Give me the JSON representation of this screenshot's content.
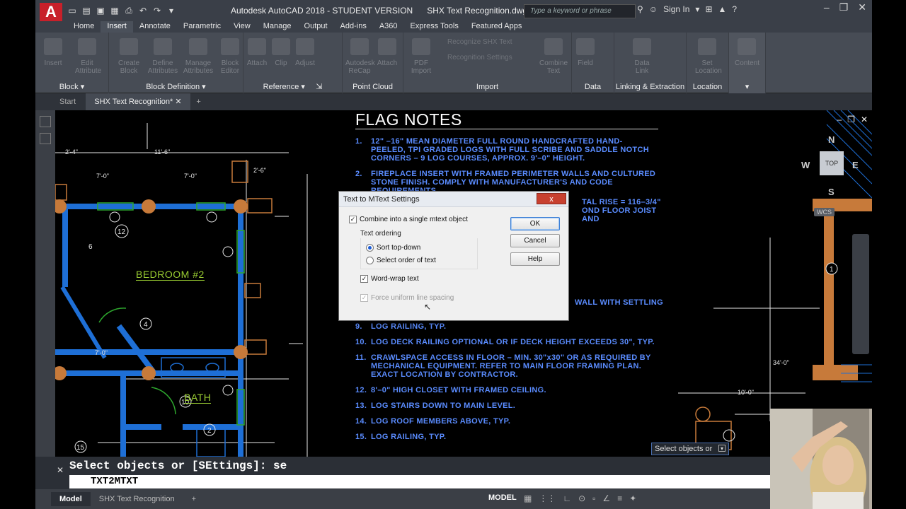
{
  "app": {
    "logo": "A",
    "title": "Autodesk AutoCAD 2018 - STUDENT VERSION",
    "filename": "SHX Text Recognition.dwg",
    "search_placeholder": "Type a keyword or phrase",
    "sign_in": "Sign In"
  },
  "ribbon_tabs": [
    "Home",
    "Insert",
    "Annotate",
    "Parametric",
    "View",
    "Manage",
    "Output",
    "Add-ins",
    "A360",
    "Express Tools",
    "Featured Apps"
  ],
  "ribbon": {
    "block": {
      "label": "Block",
      "buttons": [
        "Insert",
        "Edit Attribute"
      ]
    },
    "block_definition": {
      "label": "Block Definition",
      "buttons": [
        "Create Block",
        "Define Attributes",
        "Manage Attributes",
        "Block Editor"
      ]
    },
    "reference": {
      "label": "Reference",
      "buttons": [
        "Attach",
        "Clip",
        "Adjust"
      ]
    },
    "point_cloud": {
      "label": "Point Cloud",
      "buttons": [
        "Autodesk ReCap",
        "Attach"
      ]
    },
    "import": {
      "label": "Import",
      "buttons": [
        "PDF Import",
        "Combine Text"
      ],
      "sub": [
        "Recognize SHX Text",
        "Recognition Settings"
      ]
    },
    "data": {
      "label": "Data",
      "buttons": [
        "Field"
      ]
    },
    "linking": {
      "label": "Linking & Extraction",
      "buttons": [
        "Data Link"
      ]
    },
    "location": {
      "label": "Location",
      "buttons": [
        "Set Location"
      ]
    },
    "content": {
      "label": "Content"
    }
  },
  "doc_tabs": {
    "start": "Start",
    "active": "SHX Text Recognition*"
  },
  "drawing": {
    "notes_title": "FLAG NOTES",
    "notes": [
      {
        "n": "1.",
        "text": "12\" –16\" MEAN DIAMETER FULL ROUND HANDCRAFTED HAND-PEELED, TPI GRADED LOGS WITH FULL SCRIBE AND SADDLE NOTCH CORNERS – 9 LOG COURSES, APPROX. 9'–0\" HEIGHT."
      },
      {
        "n": "2.",
        "text": "FIREPLACE INSERT WITH FRAMED PERIMETER WALLS AND CULTURED STONE FINISH. COMPLY WITH MANUFACTURER'S AND CODE REQUIREMENTS."
      }
    ],
    "notes_lower": [
      {
        "n": "9.",
        "text": "LOG RAILING, TYP."
      },
      {
        "n": "10.",
        "text": "LOG DECK RAILING OPTIONAL OR IF DECK HEIGHT EXCEEDS 30\", TYP."
      },
      {
        "n": "11.",
        "text": "CRAWLSPACE ACCESS IN FLOOR – MIN. 30\"x30\" OR AS REQUIRED BY MECHANICAL EQUIPMENT. REFER TO MAIN FLOOR FRAMING PLAN. EXACT LOCATION BY CONTRACTOR."
      },
      {
        "n": "12.",
        "text": "8'–0\" HIGH CLOSET WITH FRAMED CEILING."
      },
      {
        "n": "13.",
        "text": "LOG STAIRS DOWN TO MAIN LEVEL."
      },
      {
        "n": "14.",
        "text": "LOG ROOF MEMBERS ABOVE, TYP."
      },
      {
        "n": "15.",
        "text": "LOG RAILING, TYP."
      }
    ],
    "note_fragments": [
      "TAL RISE = 116–3/4\"",
      "OND FLOOR JOIST AND",
      "WALL WITH SETTLING"
    ],
    "room_bedroom": "BEDROOM #2",
    "room_bath": "BATH",
    "dims": [
      "2'-4\"",
      "11'-6\"",
      "7'-0\"",
      "7'-0\"",
      "2'-6\"",
      "7'-0\"",
      "10'-0\"",
      "34'-0\""
    ],
    "tags": [
      "12",
      "6",
      "4",
      "10",
      "2",
      "15",
      "1"
    ],
    "compass": {
      "n": "N",
      "s": "S",
      "e": "E",
      "w": "W",
      "top": "TOP",
      "wcs": "WCS"
    },
    "tooltip": "Select objects or"
  },
  "dialog": {
    "title": "Text to MText Settings",
    "close": "x",
    "combine": "Combine into a single mtext object",
    "combine_checked": true,
    "group_label": "Text ordering",
    "sort_top_down": "Sort top-down",
    "select_order": "Select order of text",
    "selected_order": "sort_top_down",
    "word_wrap": "Word-wrap text",
    "word_wrap_checked": true,
    "force_uniform": "Force uniform line spacing",
    "force_uniform_checked": true,
    "ok": "OK",
    "cancel": "Cancel",
    "help": "Help"
  },
  "command": {
    "history": "Select objects or [SEttings]: se",
    "input": "TXT2MTXT"
  },
  "status": {
    "layouts": [
      "Model",
      "SHX Text Recognition"
    ],
    "model": "MODEL"
  },
  "colors": {
    "wall": "#1e6fd6",
    "log": "#c77a3a",
    "notes": "#5a8cff",
    "room": "#9acd32"
  }
}
